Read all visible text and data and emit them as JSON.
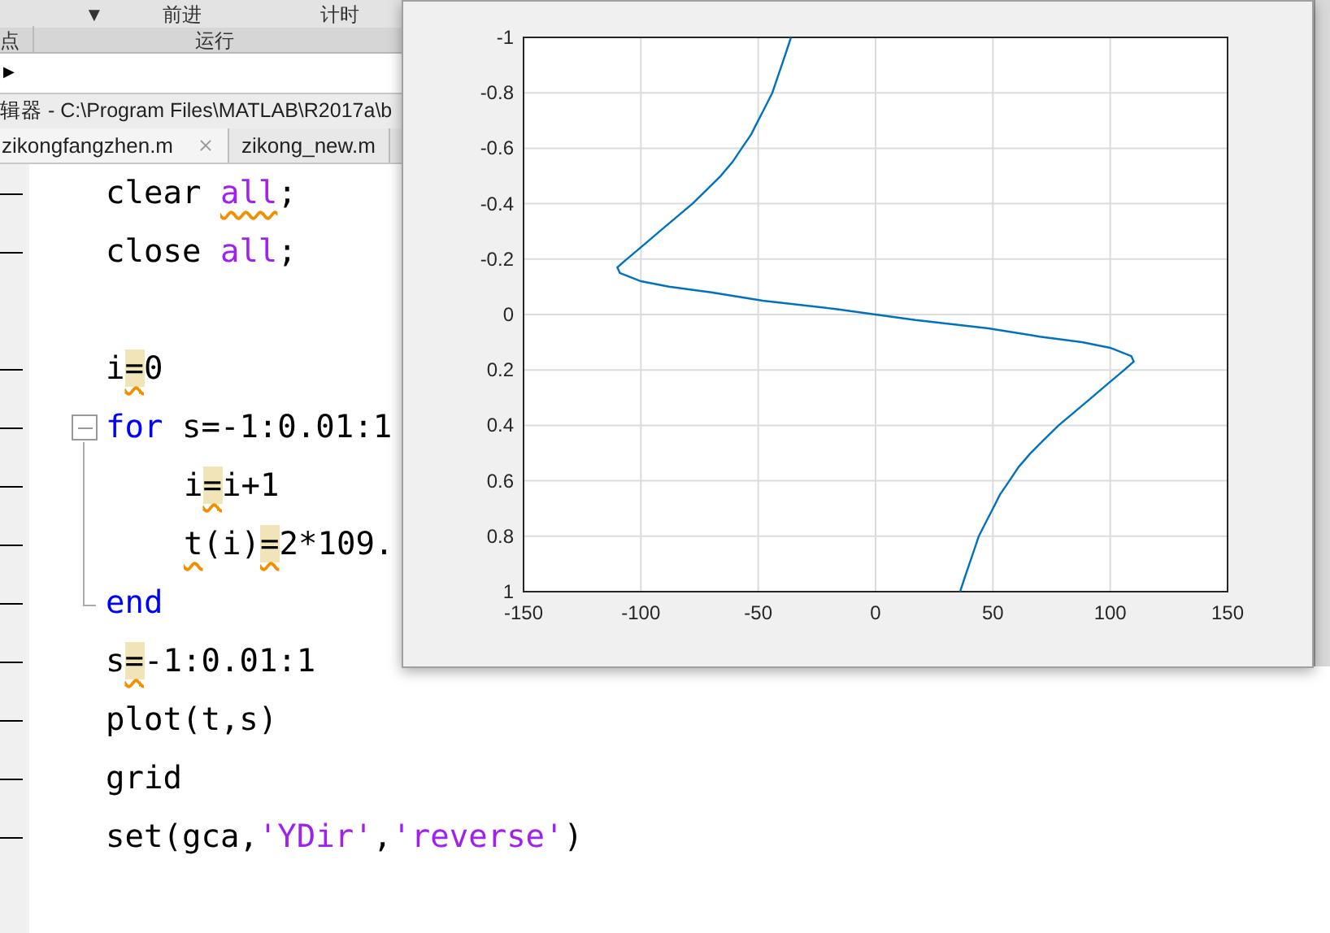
{
  "ribbon": {
    "top_labels": [
      "▼",
      "前进",
      "计时"
    ],
    "section_labels": [
      "点",
      "运行"
    ]
  },
  "address_bar": {
    "arrow": "▶"
  },
  "editor_title": "辑器 - C:\\Program Files\\MATLAB\\R2017a\\b",
  "tabs": [
    {
      "label": "zikongfangzhen.m",
      "selected": true,
      "closable": true
    },
    {
      "label": "zikong_new.m",
      "selected": false,
      "closable": false
    }
  ],
  "code_lines": [
    {
      "tokens": [
        {
          "text": "clear ",
          "kind": "plain"
        },
        {
          "text": "all",
          "kind": "string",
          "warn": true
        },
        {
          "text": ";",
          "kind": "plain"
        }
      ]
    },
    {
      "tokens": [
        {
          "text": "close ",
          "kind": "plain"
        },
        {
          "text": "all",
          "kind": "string"
        },
        {
          "text": ";",
          "kind": "plain"
        }
      ]
    },
    {
      "kind": "blank"
    },
    {
      "tokens": [
        {
          "text": "i",
          "kind": "plain"
        },
        {
          "text": "=",
          "kind": "plain",
          "warn": true,
          "highlight": true
        },
        {
          "text": "0",
          "kind": "plain"
        }
      ]
    },
    {
      "tokens": [
        {
          "text": "for",
          "kind": "keyword"
        },
        {
          "text": " s=-1:0.01:1",
          "kind": "plain"
        }
      ],
      "children": [
        {
          "tokens": [
            {
              "text": "i",
              "kind": "plain"
            },
            {
              "text": "=",
              "kind": "plain",
              "warn": true,
              "highlight": true
            },
            {
              "text": "i+1",
              "kind": "plain"
            }
          ]
        },
        {
          "tokens": [
            {
              "text": "t",
              "kind": "plain",
              "warn": true
            },
            {
              "text": "(i)",
              "kind": "plain"
            },
            {
              "text": "=",
              "kind": "plain",
              "warn": true,
              "highlight": true
            },
            {
              "text": "2*109.",
              "kind": "plain"
            }
          ]
        }
      ],
      "closing": [
        {
          "text": "end",
          "kind": "keyword"
        }
      ]
    },
    {
      "tokens": [
        {
          "text": "s",
          "kind": "plain"
        },
        {
          "text": "=",
          "kind": "plain",
          "warn": true,
          "highlight": true
        },
        {
          "text": "-1:0.01:1",
          "kind": "plain"
        }
      ]
    },
    {
      "tokens": [
        {
          "text": "plot(t,s)",
          "kind": "plain"
        }
      ]
    },
    {
      "tokens": [
        {
          "text": "grid",
          "kind": "plain"
        }
      ]
    },
    {
      "tokens": [
        {
          "text": "set(gca,",
          "kind": "plain"
        },
        {
          "text": "'YDir'",
          "kind": "string"
        },
        {
          "text": ",",
          "kind": "plain"
        },
        {
          "text": "'reverse'",
          "kind": "string"
        },
        {
          "text": ")",
          "kind": "plain"
        }
      ]
    }
  ],
  "figure": {
    "chart_data": {
      "type": "line",
      "x": [
        -36,
        -38,
        -40,
        -42,
        -44,
        -47,
        -50,
        -53,
        -57,
        -61,
        -66,
        -72,
        -78,
        -85,
        -92,
        -99,
        -106,
        -110,
        -109,
        -100,
        -88,
        -70,
        -48,
        -17,
        0,
        17,
        48,
        70,
        88,
        100,
        109,
        110,
        106,
        99,
        92,
        85,
        78,
        72,
        66,
        61,
        57,
        53,
        50,
        47,
        44,
        42,
        40,
        38,
        36
      ],
      "series": [
        {
          "color": "#0072bd",
          "values": [
            -1,
            -0.95,
            -0.9,
            -0.85,
            -0.8,
            -0.75,
            -0.7,
            -0.65,
            -0.6,
            -0.55,
            -0.5,
            -0.45,
            -0.4,
            -0.35,
            -0.3,
            -0.25,
            -0.2,
            -0.17,
            -0.15,
            -0.12,
            -0.1,
            -0.08,
            -0.05,
            -0.02,
            0,
            0.02,
            0.05,
            0.08,
            0.1,
            0.12,
            0.15,
            0.17,
            0.2,
            0.25,
            0.3,
            0.35,
            0.4,
            0.45,
            0.5,
            0.55,
            0.6,
            0.65,
            0.7,
            0.75,
            0.8,
            0.85,
            0.9,
            0.95,
            1
          ]
        }
      ],
      "xlim": [
        -150,
        150
      ],
      "ylim": [
        1,
        -1
      ],
      "grid": true,
      "xticks": [
        -150,
        -100,
        -50,
        0,
        50,
        100,
        150
      ],
      "yticks": [
        -1,
        -0.8,
        -0.6,
        -0.4,
        -0.2,
        0,
        0.2,
        0.4,
        0.6,
        0.8,
        1
      ]
    }
  }
}
